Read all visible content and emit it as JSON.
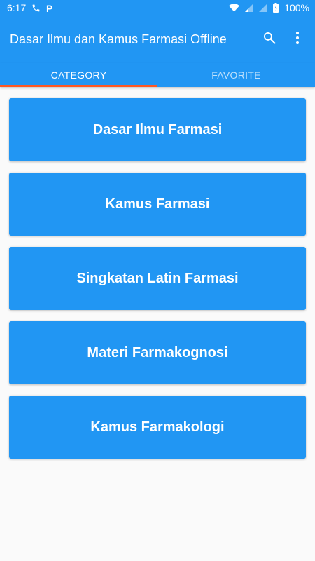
{
  "status_bar": {
    "time": "6:17",
    "battery": "100%"
  },
  "app_bar": {
    "title": "Dasar Ilmu dan Kamus Farmasi Offline",
    "search_icon": "search-icon",
    "menu_icon": "more-vert-icon"
  },
  "tabs": [
    {
      "label": "CATEGORY",
      "active": true
    },
    {
      "label": "FAVORITE",
      "active": false
    }
  ],
  "categories": [
    {
      "label": "Dasar Ilmu Farmasi"
    },
    {
      "label": "Kamus Farmasi"
    },
    {
      "label": "Singkatan Latin Farmasi"
    },
    {
      "label": "Materi Farmakognosi"
    },
    {
      "label": "Kamus Farmakologi"
    }
  ],
  "colors": {
    "primary": "#2196f3",
    "tab_indicator": "#ff5722",
    "background": "#fafafa"
  }
}
